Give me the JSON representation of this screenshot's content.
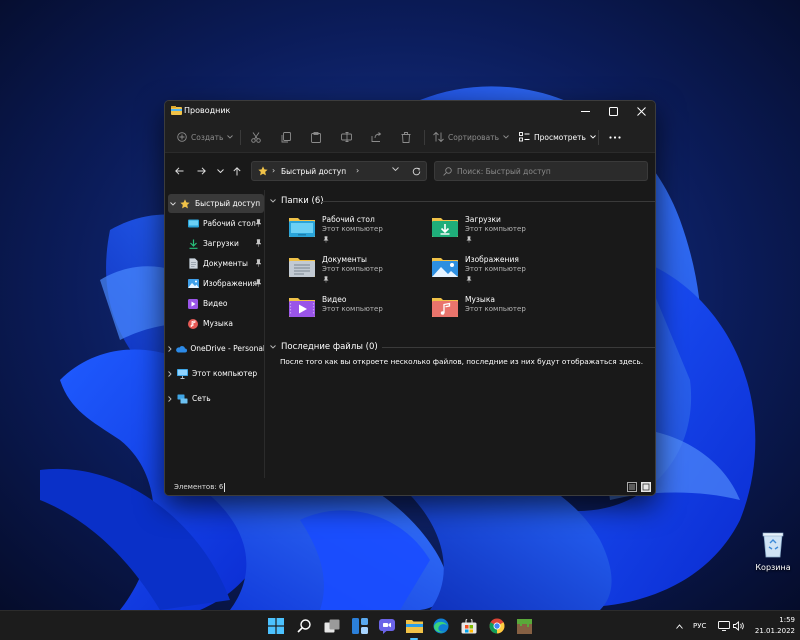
{
  "window": {
    "title": "Проводник",
    "controls": {
      "minimize": "minimize",
      "maximize": "maximize",
      "close": "close"
    }
  },
  "commandbar": {
    "new_label": "Создать",
    "sort_label": "Сортировать",
    "view_label": "Просмотреть",
    "icons": [
      "add-icon",
      "cut-icon",
      "copy-icon",
      "paste-icon",
      "rename-icon",
      "share-icon",
      "delete-icon",
      "sort-icon",
      "view-icon",
      "more-icon"
    ]
  },
  "address": {
    "path": "Быстрый доступ",
    "search_placeholder": "Поиск: Быстрый доступ"
  },
  "sidebar": {
    "quick_access": "Быстрый доступ",
    "items": [
      {
        "label": "Рабочий стол",
        "icon": "desktop-folder-icon",
        "pinned": true
      },
      {
        "label": "Загрузки",
        "icon": "downloads-icon",
        "pinned": true
      },
      {
        "label": "Документы",
        "icon": "documents-icon",
        "pinned": true
      },
      {
        "label": "Изображения",
        "icon": "pictures-icon",
        "pinned": true
      },
      {
        "label": "Видео",
        "icon": "videos-icon",
        "pinned": false
      },
      {
        "label": "Музыка",
        "icon": "music-icon",
        "pinned": false
      }
    ],
    "onedrive": "OneDrive - Personal",
    "this_pc": "Этот компьютер",
    "network": "Сеть"
  },
  "content": {
    "folders_header": "Папки (6)",
    "folders": [
      {
        "name": "Рабочий стол",
        "location": "Этот компьютер",
        "pinned": true,
        "icon": "desktop-folder-icon"
      },
      {
        "name": "Загрузки",
        "location": "Этот компьютер",
        "pinned": true,
        "icon": "downloads-folder-icon"
      },
      {
        "name": "Документы",
        "location": "Этот компьютер",
        "pinned": true,
        "icon": "documents-folder-icon"
      },
      {
        "name": "Изображения",
        "location": "Этот компьютер",
        "pinned": true,
        "icon": "pictures-folder-icon"
      },
      {
        "name": "Видео",
        "location": "Этот компьютер",
        "pinned": false,
        "icon": "videos-folder-icon"
      },
      {
        "name": "Музыка",
        "location": "Этот компьютер",
        "pinned": false,
        "icon": "music-folder-icon"
      }
    ],
    "recent_header": "Последние файлы (0)",
    "recent_empty": "После того как вы откроете несколько файлов, последние из них будут отображаться здесь."
  },
  "statusbar": {
    "items_count": "Элементов: 6"
  },
  "desktop": {
    "recycle_bin": "Корзина"
  },
  "taskbar": {
    "apps": [
      "start-icon",
      "search-icon",
      "task-view-icon",
      "widgets-icon",
      "teams-chat-icon",
      "file-explorer-icon",
      "edge-icon",
      "store-icon",
      "chrome-icon",
      "minecraft-icon"
    ],
    "language": "РУС",
    "time": "1:59",
    "date": "21.01.2022"
  },
  "colors": {
    "accent": "#4cc2ff",
    "window_bg": "#191919",
    "chrome_bg": "#202020",
    "folder_yellow": "#f0c248"
  }
}
